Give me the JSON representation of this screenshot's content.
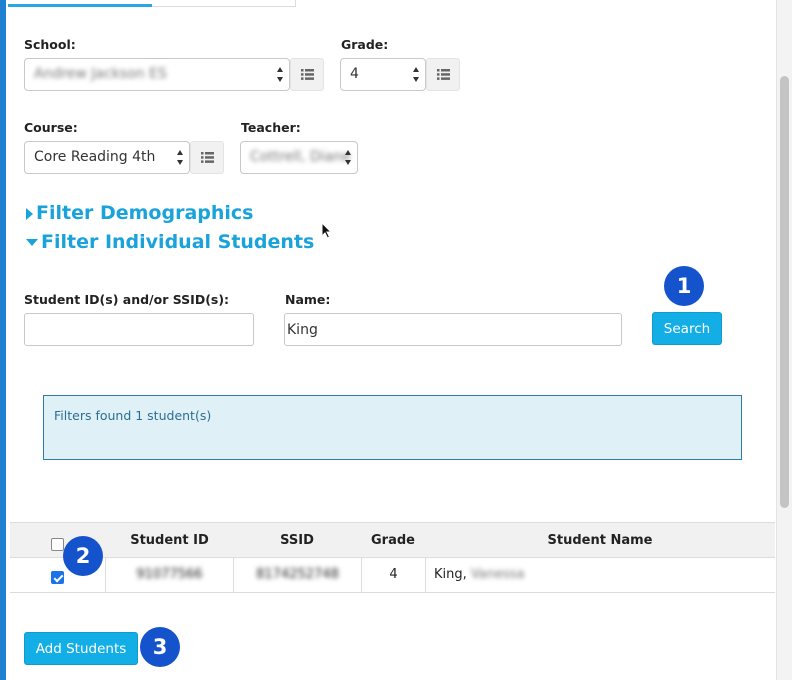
{
  "filters": {
    "school": {
      "label": "School:",
      "value": "Andrew Jackson ES"
    },
    "grade": {
      "label": "Grade:",
      "value": "4"
    },
    "course": {
      "label": "Course:",
      "value": "Core Reading 4th"
    },
    "teacher": {
      "label": "Teacher:",
      "value": "Cottrell, Diane"
    },
    "list_icon": "list-icon"
  },
  "sections": {
    "demographics": "Filter Demographics",
    "individual": "Filter Individual Students"
  },
  "search_form": {
    "student_id_label": "Student ID(s) and/or SSID(s):",
    "student_id_value": "",
    "name_label": "Name:",
    "name_value": "King",
    "search_button": "Search"
  },
  "result_message": "Filters found 1 student(s)",
  "table": {
    "columns": [
      "Student ID",
      "SSID",
      "Grade",
      "Student Name"
    ],
    "rows": [
      {
        "checked": true,
        "student_id": "91077566",
        "ssid": "8174252748",
        "grade": "4",
        "last_name": "King,",
        "first_name": "Vanessa"
      }
    ]
  },
  "add_button": "Add Students",
  "callouts": [
    "1",
    "2",
    "3"
  ],
  "colors": {
    "accent": "#1aa3da",
    "button": "#13aee5",
    "callout": "#1553cc",
    "alert_bg": "#dff0f7"
  }
}
